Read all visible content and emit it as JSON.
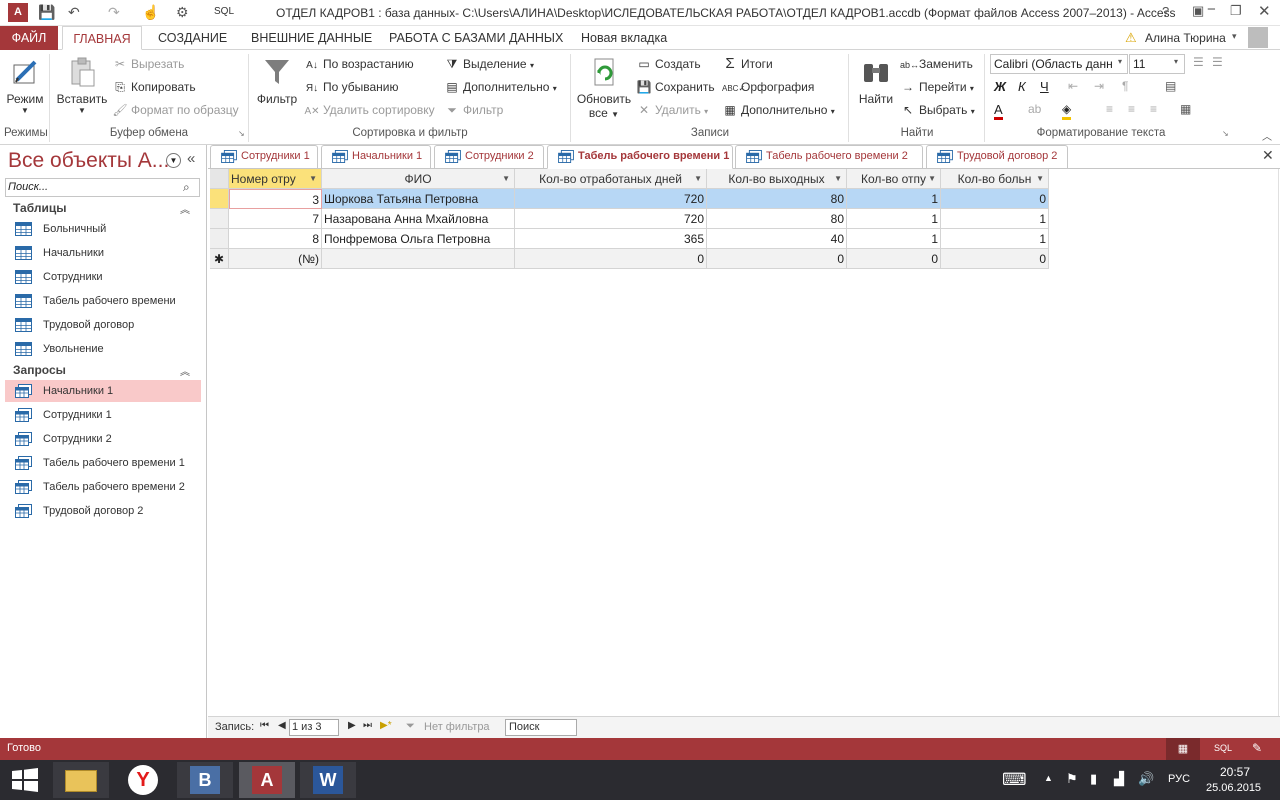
{
  "window": {
    "title": "ОТДЕЛ КАДРОВ1 : база данных- C:\\Users\\АЛИНА\\Desktop\\ИСЛЕДОВАТЕЛЬСКАЯ РАБОТА\\ОТДЕЛ КАДРОВ1.accdb (Формат файлов Access 2007–2013) - Access",
    "user": "Алина Тюрина",
    "sql_label": "SQL"
  },
  "ribbon_tabs": [
    "ФАЙЛ",
    "ГЛАВНАЯ",
    "СОЗДАНИЕ",
    "ВНЕШНИЕ ДАННЫЕ",
    "РАБОТА С БАЗАМИ ДАННЫХ",
    "Новая вкладка"
  ],
  "ribbon": {
    "views": {
      "mode": "Режим",
      "group": "Режимы"
    },
    "clipboard": {
      "paste": "Вставить",
      "cut": "Вырезать",
      "copy": "Копировать",
      "format_painter": "Формат по образцу",
      "group": "Буфер обмена"
    },
    "sort_filter": {
      "filter": "Фильтр",
      "asc": "По возрастанию",
      "desc": "По убыванию",
      "remove_sort": "Удалить сортировку",
      "selection": "Выделение",
      "advanced": "Дополнительно",
      "toggle_filter": "Фильтр",
      "group": "Сортировка и фильтр"
    },
    "records": {
      "refresh": "Обновить",
      "refresh2": "все",
      "new": "Создать",
      "save": "Сохранить",
      "delete": "Удалить",
      "totals": "Итоги",
      "spelling": "Орфография",
      "more": "Дополнительно",
      "group": "Записи"
    },
    "find": {
      "find": "Найти",
      "replace": "Заменить",
      "goto": "Перейти",
      "select": "Выбрать",
      "group": "Найти"
    },
    "text": {
      "font": "Calibri (Область данн",
      "size": "11",
      "bold": "Ж",
      "italic": "К",
      "underline": "Ч",
      "group": "Форматирование текста"
    }
  },
  "nav": {
    "title": "Все объекты А...",
    "search_placeholder": "Поиск...",
    "tables_header": "Таблицы",
    "tables": [
      "Больничный",
      "Начальники",
      "Сотрудники",
      "Табель рабочего времени",
      "Трудовой договор",
      "Увольнение"
    ],
    "queries_header": "Запросы",
    "queries": [
      "Начальники 1",
      "Сотрудники 1",
      "Сотрудники 2",
      "Табель рабочего времени 1",
      "Табель рабочего времени 2",
      "Трудовой договор 2"
    ]
  },
  "doc_tabs": [
    "Сотрудники 1",
    "Начальники 1",
    "Сотрудники 2",
    "Табель рабочего времени 1",
    "Табель рабочего времени 2",
    "Трудовой договор 2"
  ],
  "grid": {
    "columns": [
      "Номер отру",
      "ФИО",
      "Кол-во отработаных дней",
      "Кол-во выходных",
      "Кол-во отпу",
      "Кол-во больн"
    ],
    "rows": [
      [
        "3",
        "Шоркова Татьяна Петровна",
        "720",
        "80",
        "1",
        "0"
      ],
      [
        "7",
        "Назарована Анна Мхайловна",
        "720",
        "80",
        "1",
        "1"
      ],
      [
        "8",
        "Понфремова Ольга Петровна",
        "365",
        "40",
        "1",
        "1"
      ]
    ],
    "new_row": [
      "(№)",
      "",
      "0",
      "0",
      "0",
      "0"
    ]
  },
  "record_nav": {
    "label": "Запись:",
    "position": "1 из 3",
    "no_filter": "Нет фильтра",
    "search": "Поиск"
  },
  "status": {
    "text": "Готово",
    "sql": "SQL"
  },
  "taskbar": {
    "lang": "РУС",
    "time": "20:57",
    "date": "25.06.2015"
  },
  "colors": {
    "accent": "#a4373a",
    "selection": "#b7d7f5",
    "taskbar": "#2b2b30"
  }
}
